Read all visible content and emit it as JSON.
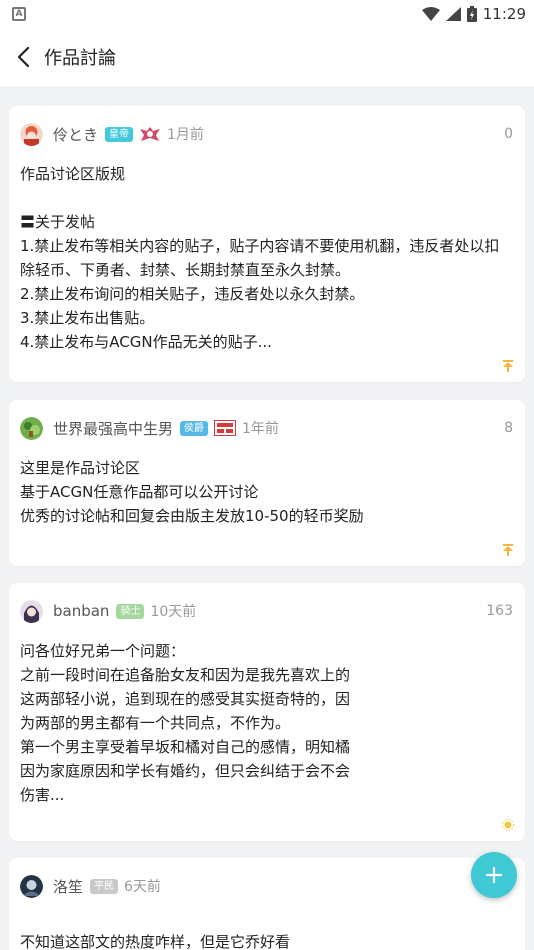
{
  "status_bar": {
    "left_icon": "A",
    "time": "11:29"
  },
  "header": {
    "title": "作品討論"
  },
  "colors": {
    "accent": "#3ec9d5",
    "badge_emperor": "#46c8dc",
    "badge_marquis": "#55b8e6",
    "badge_knight": "#a7d7a0",
    "badge_commoner": "#c9c9c9",
    "pin": "#f3b544",
    "text_dark": "#222222",
    "text_muted": "#999999"
  },
  "posts": [
    {
      "username": "伶とき",
      "badge": "皇帝",
      "time": "1月前",
      "count": "0",
      "content": "作品讨论区版规\n\n〓关于发帖\n1.禁止发布等相关内容的贴子，贴子内容请不要使用机翻，违反者处以扣除轻币、下勇者、封禁、长期封禁直至永久封禁。\n2.禁止发布询问的相关贴子，违反者处以永久封禁。\n3.禁止发布出售贴。\n4.禁止发布与ACGN作品无关的贴子...",
      "corner_icon": "pin-icon"
    },
    {
      "username": "世界最强高中生男",
      "badge": "侯爵",
      "time": "1年前",
      "count": "8",
      "content": "这里是作品讨论区\n基于ACGN任意作品都可以公开讨论\n优秀的讨论帖和回复会由版主发放10-50的轻币奖励",
      "corner_icon": "pin-icon"
    },
    {
      "username": "banban",
      "badge": "骑士",
      "time": "10天前",
      "count": "163",
      "content": "问各位好兄弟一个问题：\n之前一段时间在追备胎女友和因为是我先喜欢上的\n这两部轻小说，追到现在的感受其实挺奇特的，因\n为两部的男主都有一个共同点，不作为。\n第一个男主享受着早坂和橘对自己的感情，明知橘\n因为家庭原因和学长有婚约，但只会纠结于会不会\n伤害...",
      "corner_icon": "sun-icon"
    },
    {
      "username": "洛笙",
      "badge": "平民",
      "time": "6天前",
      "count": "",
      "content": "不知道这部文的热度咋样，但是它乔好看",
      "corner_icon": ""
    }
  ]
}
